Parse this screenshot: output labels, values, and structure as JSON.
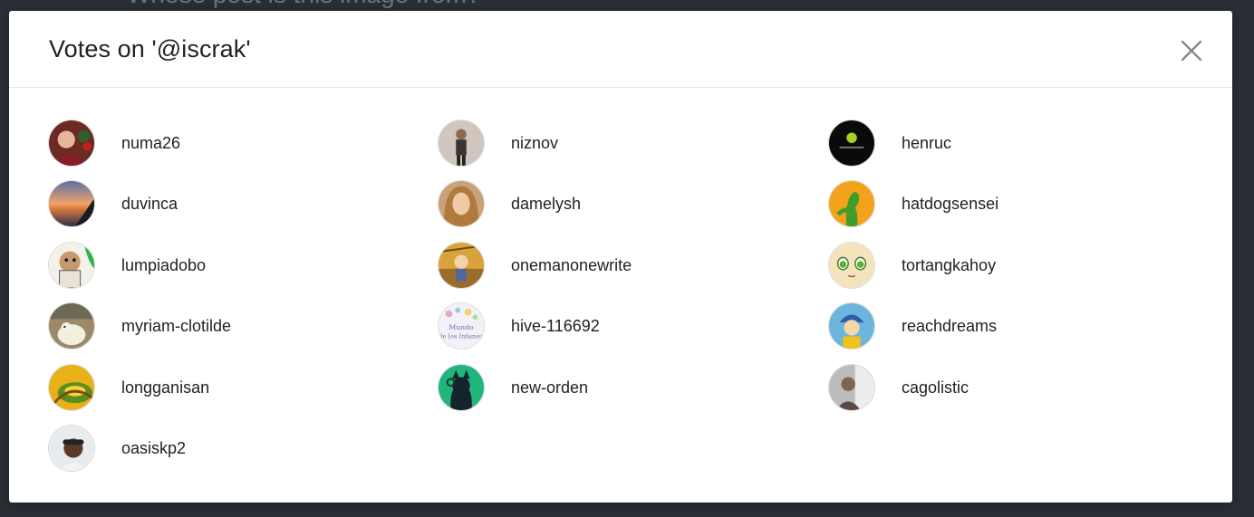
{
  "background": {
    "title": "Whose post is this image from?"
  },
  "modal": {
    "title": "Votes on '@iscrak'",
    "close_icon": "close-icon"
  },
  "voters": [
    {
      "name": "numa26",
      "avatar": "avatar-numa26"
    },
    {
      "name": "duvinca",
      "avatar": "avatar-duvinca"
    },
    {
      "name": "lumpiadobo",
      "avatar": "avatar-lumpiadobo"
    },
    {
      "name": "myriam-clotilde",
      "avatar": "avatar-myriam-clotilde"
    },
    {
      "name": "longganisan",
      "avatar": "avatar-longganisan"
    },
    {
      "name": "oasiskp2",
      "avatar": "avatar-oasiskp2"
    },
    {
      "name": "niznov",
      "avatar": "avatar-niznov"
    },
    {
      "name": "damelysh",
      "avatar": "avatar-damelysh"
    },
    {
      "name": "onemanonewrite",
      "avatar": "avatar-onemanonewrite"
    },
    {
      "name": "hive-116692",
      "avatar": "avatar-hive-116692"
    },
    {
      "name": "new-orden",
      "avatar": "avatar-new-orden"
    },
    {
      "name": "henruc",
      "avatar": "avatar-henruc"
    },
    {
      "name": "hatdogsensei",
      "avatar": "avatar-hatdogsensei"
    },
    {
      "name": "tortangkahoy",
      "avatar": "avatar-tortangkahoy"
    },
    {
      "name": "reachdreams",
      "avatar": "avatar-reachdreams"
    },
    {
      "name": "cagolistic",
      "avatar": "avatar-cagolistic"
    }
  ],
  "colors": {
    "backdrop": "#2a2f35",
    "modal_bg": "#ffffff",
    "text": "#222222",
    "close": "#888888"
  }
}
